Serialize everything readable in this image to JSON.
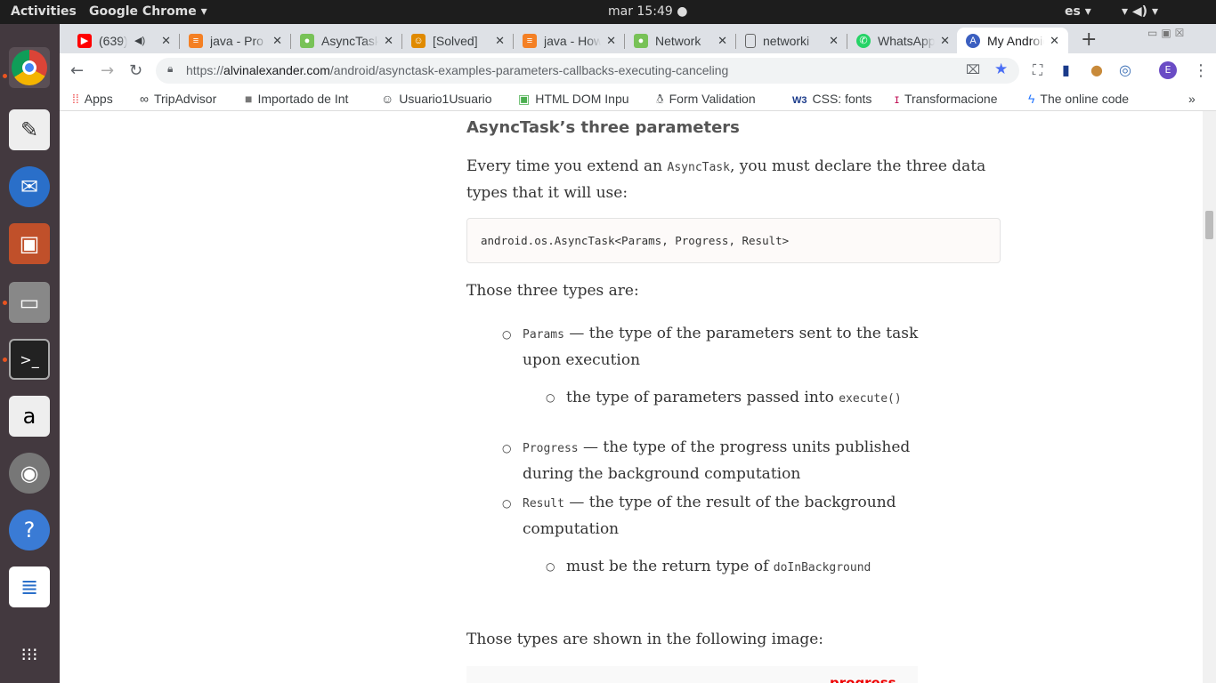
{
  "topbar": {
    "activities": "Activities",
    "app": "Google Chrome ▾",
    "clock": "mar 15:49 ●",
    "lang": "es ▾",
    "tray": "▾ ◀) ▾"
  },
  "tabs": [
    {
      "title": "(639)",
      "color": "#ff0000",
      "icon": "youtube-icon",
      "extra": "◀)"
    },
    {
      "title": "java - Pro",
      "color": "#f48024",
      "icon": "stackoverflow-icon"
    },
    {
      "title": "AsyncTask",
      "color": "#78c257",
      "icon": "android-icon"
    },
    {
      "title": "[Solved]",
      "color": "#e08a00",
      "icon": "solved-icon"
    },
    {
      "title": "java - How",
      "color": "#f48024",
      "icon": "stackoverflow-icon"
    },
    {
      "title": "Network",
      "color": "#78c257",
      "icon": "android-icon"
    },
    {
      "title": "networki",
      "color": "#888888",
      "icon": "page-icon"
    },
    {
      "title": "WhatsApp",
      "color": "#25d366",
      "icon": "whatsapp-icon"
    },
    {
      "title": "My Android",
      "color": "#3b5fc0",
      "icon": "a-icon",
      "letter": "A"
    }
  ],
  "toolbar": {
    "url_scheme": "https://",
    "url_host": "alvinalexander.com",
    "url_path": "/android/asynctask-examples-parameters-callbacks-executing-canceling",
    "profile": "E"
  },
  "bookmarks": [
    {
      "label": "Apps",
      "icon": "apps-icon"
    },
    {
      "label": "TripAdvisor",
      "icon": "tripadvisor-icon"
    },
    {
      "label": "Importado de Int",
      "icon": "folder-icon"
    },
    {
      "label": "Usuario1Usuario",
      "icon": "smiley-icon"
    },
    {
      "label": "HTML DOM Inpu",
      "icon": "w3-icon"
    },
    {
      "label": "Form Validation",
      "icon": "tux-icon"
    },
    {
      "label": "CSS: fonts",
      "icon": "w3schools-icon"
    },
    {
      "label": "Transformacione",
      "icon": "info-icon"
    },
    {
      "label": "The online code",
      "icon": "bolt-icon"
    }
  ],
  "article": {
    "heading": "AsyncTask’s three parameters",
    "p1_a": "Every time you extend an ",
    "p1_code": "AsyncTask",
    "p1_b": ", you must declare the three data types that it will use:",
    "code": "android.os.AsyncTask<Params, Progress, Result>",
    "p2": "Those three types are:",
    "items": [
      {
        "code": "Params",
        "text": " — the type of the parameters sent to the task upon execution",
        "sub_text": "the type of parameters passed into ",
        "sub_code": "execute()"
      },
      {
        "code": "Progress",
        "text": " — the type of the progress units published during the background computation"
      },
      {
        "code": "Result",
        "text": " — the type of the result of the background computation",
        "sub_text": "must be the return type of ",
        "sub_code": "doInBackground"
      }
    ],
    "p3": "Those types are shown in the following image:",
    "image_label": "progress"
  }
}
